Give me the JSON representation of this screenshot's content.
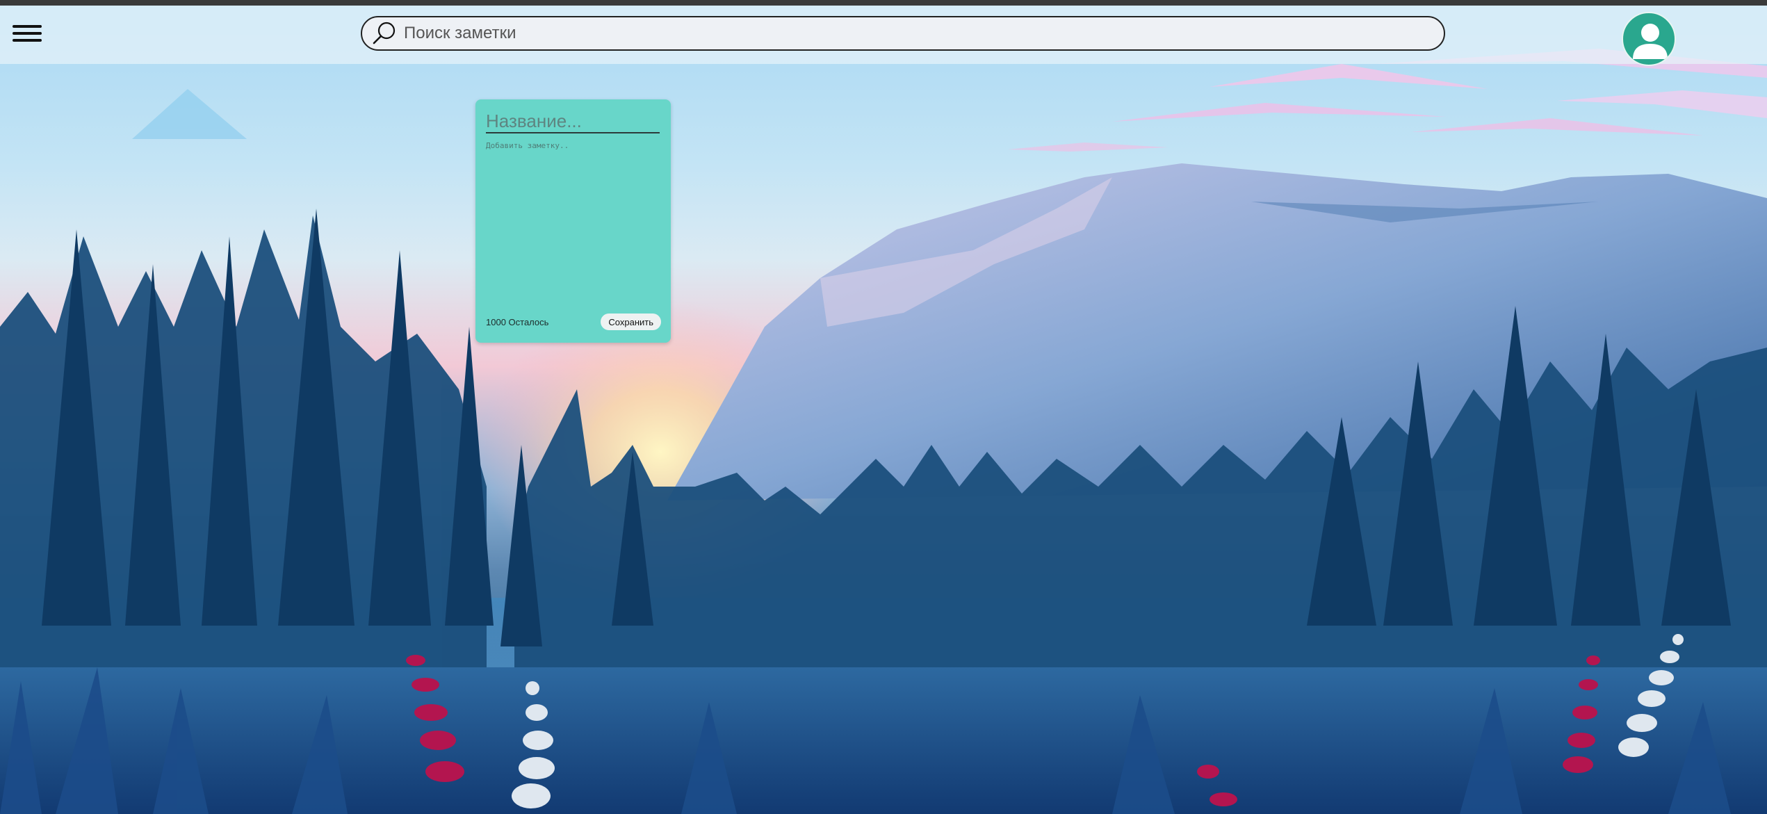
{
  "header": {
    "menu_icon": "hamburger-menu-icon",
    "search": {
      "placeholder": "Поиск заметки",
      "value": "",
      "icon": "search-icon"
    },
    "avatar_icon": "user-avatar-icon"
  },
  "note_editor": {
    "title_placeholder": "Название...",
    "title_value": "",
    "body_placeholder": "Добавить заметку..",
    "body_value": "",
    "remaining_text": "1000 Осталось",
    "save_label": "Сохранить",
    "background_color": "#68d6c9"
  },
  "colors": {
    "avatar_bg": "#2aa78e",
    "header_bar": "#3a3a3a"
  }
}
